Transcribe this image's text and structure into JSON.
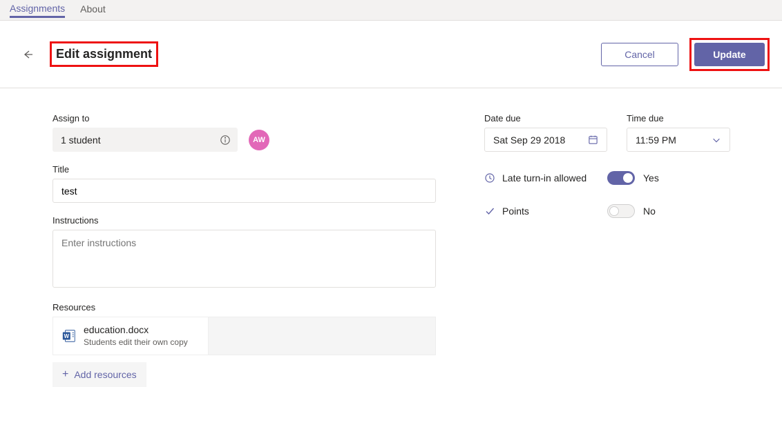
{
  "tabs": {
    "assignments": "Assignments",
    "about": "About"
  },
  "header": {
    "title": "Edit assignment",
    "cancel": "Cancel",
    "update": "Update"
  },
  "assign_to": {
    "label": "Assign to",
    "value": "1 student",
    "avatar_initials": "AW"
  },
  "title": {
    "label": "Title",
    "value": "test"
  },
  "instructions": {
    "label": "Instructions",
    "placeholder": "Enter instructions"
  },
  "resources": {
    "label": "Resources",
    "item": {
      "name": "education.docx",
      "sub": "Students edit their own copy"
    },
    "add_label": "Add resources"
  },
  "date_due": {
    "label": "Date due",
    "value": "Sat Sep 29 2018"
  },
  "time_due": {
    "label": "Time due",
    "value": "11:59 PM"
  },
  "late_turn_in": {
    "label": "Late turn-in allowed",
    "value": true,
    "text": "Yes"
  },
  "points": {
    "label": "Points",
    "value": false,
    "text": "No"
  }
}
